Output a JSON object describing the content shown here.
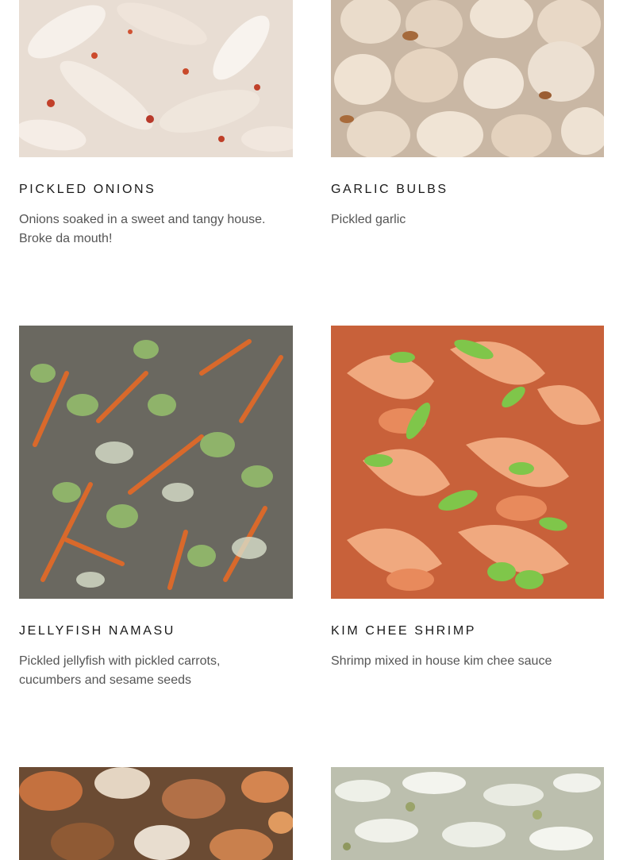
{
  "menu": {
    "items": [
      {
        "title": "PICKLED ONIONS",
        "description": "Onions soaked in a sweet and tangy house.  Broke da mouth!",
        "image": "pickled-onions-photo"
      },
      {
        "title": "GARLIC BULBS",
        "description": "Pickled garlic",
        "image": "garlic-bulbs-photo"
      },
      {
        "title": "JELLYFISH NAMASU",
        "description": "Pickled jellyfish with pickled carrots, cucumbers and sesame seeds",
        "image": "jellyfish-namasu-photo"
      },
      {
        "title": "KIM CHEE SHRIMP",
        "description": "Shrimp mixed in house kim chee sauce",
        "image": "kim-chee-shrimp-photo"
      },
      {
        "title": "",
        "description": "",
        "image": "crab-dish-photo"
      },
      {
        "title": "",
        "description": "",
        "image": "white-pickle-photo"
      }
    ]
  },
  "colors": {
    "title_text": "#1a1a1a",
    "description_text": "#555555",
    "background": "#ffffff"
  }
}
